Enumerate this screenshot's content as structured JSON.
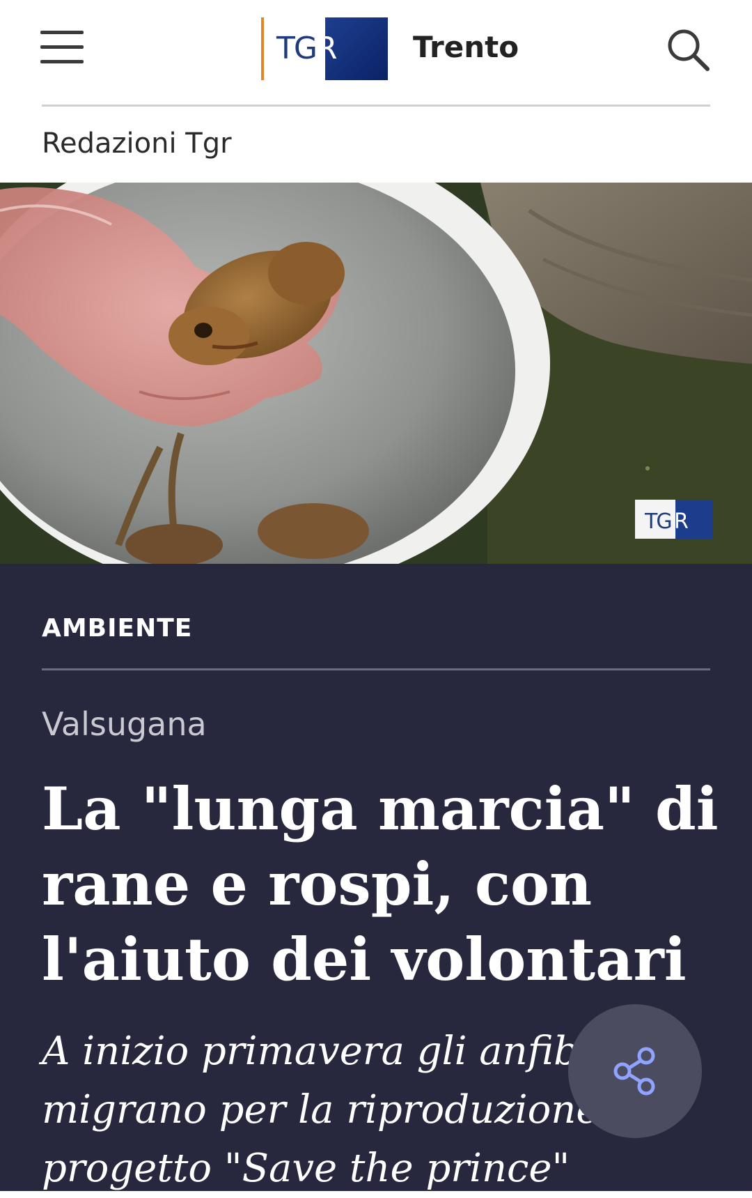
{
  "header": {
    "menu_icon": "hamburger-menu-icon",
    "logo_text_main": "TG",
    "logo_text_r": "R",
    "region": "Trento",
    "search_icon": "search-icon"
  },
  "nav": {
    "redazioni_label": "Redazioni Tgr"
  },
  "hero": {
    "watermark_main": "TG",
    "watermark_r": "R"
  },
  "article": {
    "category": "AMBIENTE",
    "location": "Valsugana",
    "headline": "La \"lunga marcia\" di rane e rospi, con l'aiuto dei volontari",
    "subtitle": "A inizio primavera gli anfibi migrano per la riproduzione. progetto \"Save the prince\""
  },
  "share": {
    "icon": "share-icon"
  },
  "colors": {
    "article_bg": "#27283d",
    "logo_blue": "#1d3f8f",
    "logo_accent": "#e0862a",
    "share_bg": "#4b4c5f",
    "share_icon": "#8fa3ff"
  }
}
